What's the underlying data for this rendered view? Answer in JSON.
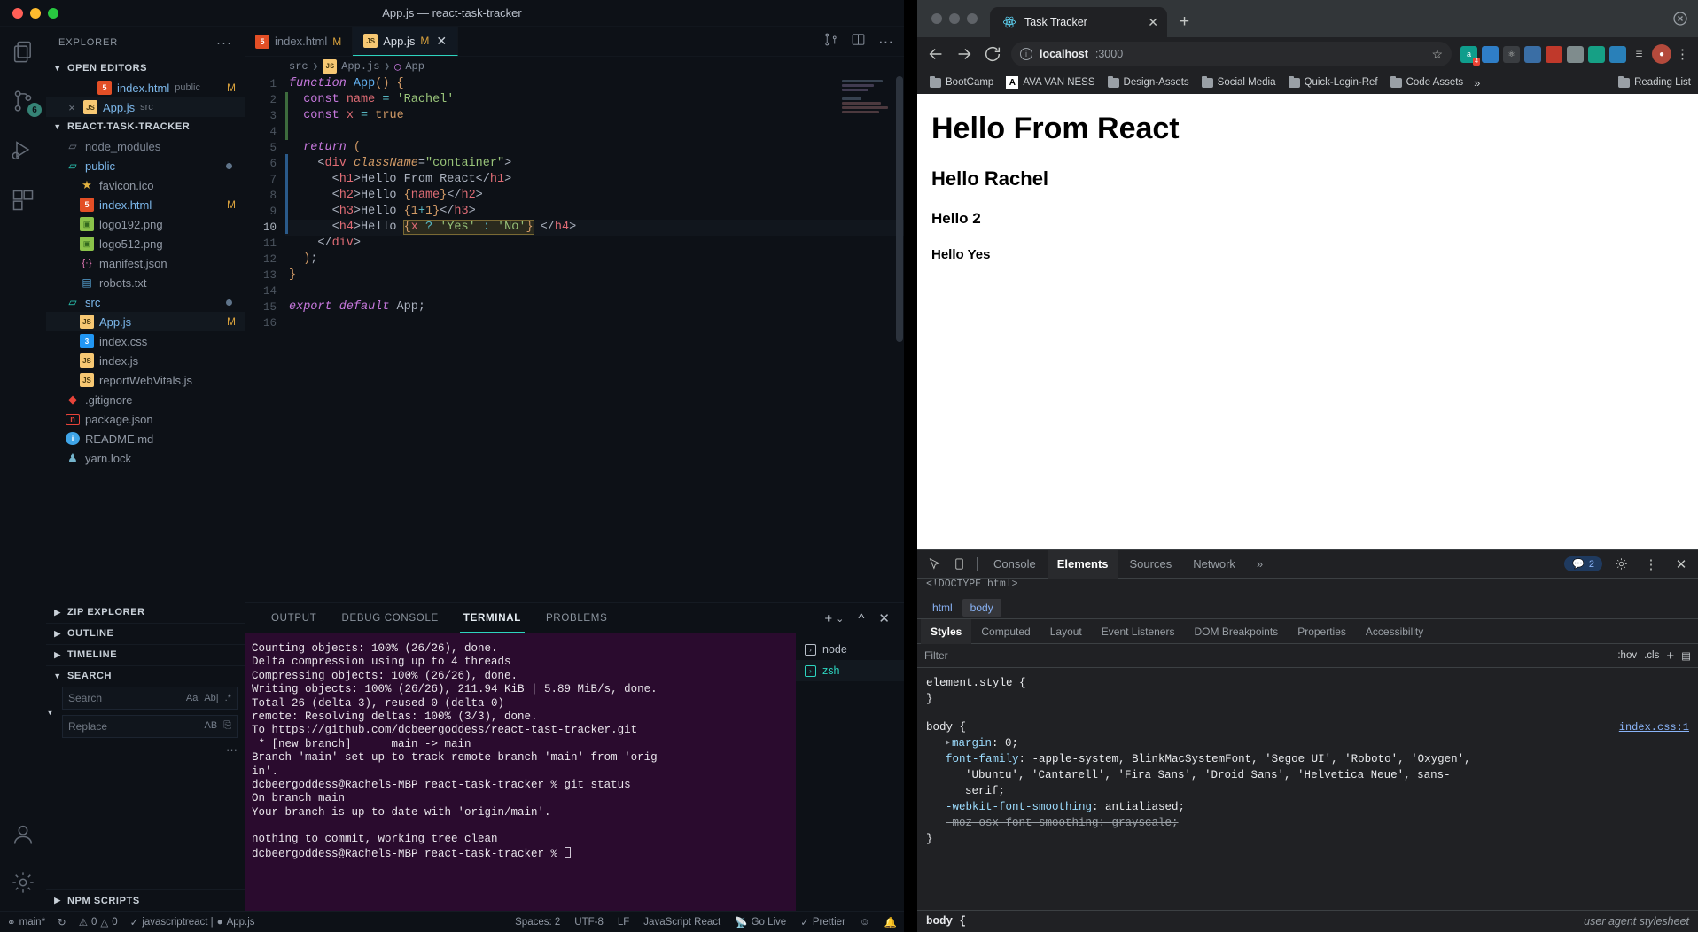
{
  "vscode": {
    "window_title": "App.js — react-task-tracker",
    "explorer_title": "EXPLORER",
    "sections": {
      "open_editors": "OPEN EDITORS",
      "project": "REACT-TASK-TRACKER",
      "zip_explorer": "ZIP EXPLORER",
      "outline": "OUTLINE",
      "timeline": "TIMELINE",
      "search": "SEARCH",
      "npm_scripts": "NPM SCRIPTS"
    },
    "open_editors": [
      {
        "name": "index.html",
        "folder": "public",
        "icon": "html-icon",
        "badge": "M",
        "close": ""
      },
      {
        "name": "App.js",
        "folder": "src",
        "icon": "js-icon",
        "badge": "",
        "close": "×"
      }
    ],
    "tree": [
      {
        "name": "node_modules",
        "icon": "folder-node-icon",
        "type": "folder-dim",
        "indent": 1,
        "badge": ""
      },
      {
        "name": "public",
        "icon": "folder-open-icon",
        "type": "folder",
        "indent": 1,
        "badge": "dot"
      },
      {
        "name": "favicon.ico",
        "icon": "star-icon",
        "type": "file",
        "indent": 2,
        "badge": ""
      },
      {
        "name": "index.html",
        "icon": "html-icon",
        "type": "file-blue",
        "indent": 2,
        "badge": "M"
      },
      {
        "name": "logo192.png",
        "icon": "image-icon",
        "type": "file",
        "indent": 2,
        "badge": ""
      },
      {
        "name": "logo512.png",
        "icon": "image-icon",
        "type": "file",
        "indent": 2,
        "badge": ""
      },
      {
        "name": "manifest.json",
        "icon": "json-icon",
        "type": "file",
        "indent": 2,
        "badge": ""
      },
      {
        "name": "robots.txt",
        "icon": "text-icon",
        "type": "file",
        "indent": 2,
        "badge": ""
      },
      {
        "name": "src",
        "icon": "folder-src-icon",
        "type": "folder",
        "indent": 1,
        "badge": "dot"
      },
      {
        "name": "App.js",
        "icon": "js-icon",
        "type": "file-blue-active",
        "indent": 2,
        "badge": "M"
      },
      {
        "name": "index.css",
        "icon": "css-icon",
        "type": "file",
        "indent": 2,
        "badge": ""
      },
      {
        "name": "index.js",
        "icon": "js-icon",
        "type": "file",
        "indent": 2,
        "badge": ""
      },
      {
        "name": "reportWebVitals.js",
        "icon": "js-icon",
        "type": "file",
        "indent": 2,
        "badge": ""
      },
      {
        "name": ".gitignore",
        "icon": "git-icon",
        "type": "file",
        "indent": 1,
        "badge": ""
      },
      {
        "name": "package.json",
        "icon": "npm-icon",
        "type": "file",
        "indent": 1,
        "badge": ""
      },
      {
        "name": "README.md",
        "icon": "info-icon",
        "type": "file",
        "indent": 1,
        "badge": ""
      },
      {
        "name": "yarn.lock",
        "icon": "yarn-icon",
        "type": "file",
        "indent": 1,
        "badge": ""
      }
    ],
    "search": {
      "search_placeholder": "Search",
      "replace_placeholder": "Replace",
      "opt_case": "Aa",
      "opt_word": "Ab|",
      "opt_regex": ".*",
      "opt_preserve": "AB",
      "opt_replace_all": "⎘",
      "more_dots": "···"
    },
    "tabs": [
      {
        "label": "index.html",
        "icon": "html-icon",
        "badge": "M",
        "active": false
      },
      {
        "label": "App.js",
        "icon": "js-icon",
        "badge": "M",
        "active": true
      }
    ],
    "breadcrumb": [
      "src",
      "App.js",
      "App"
    ],
    "editor": {
      "line_count": 16,
      "current_line": 10,
      "lines": [
        "function App() {",
        "  const name = 'Rachel'",
        "  const x = true",
        "",
        "  return (",
        "    <div className=\"container\">",
        "      <h1>Hello From React</h1>",
        "      <h2>Hello {name}</h2>",
        "      <h3>Hello {1+1}</h3>",
        "      <h4>Hello {x ? 'Yes' : 'No'} </h4>",
        "    </div>",
        "  );",
        "}",
        "",
        "export default App;",
        ""
      ]
    },
    "panel_tabs": [
      {
        "label": "OUTPUT",
        "active": false
      },
      {
        "label": "DEBUG CONSOLE",
        "active": false
      },
      {
        "label": "TERMINAL",
        "active": true
      },
      {
        "label": "PROBLEMS",
        "active": false
      }
    ],
    "terminal_lines": [
      "Counting objects: 100% (26/26), done.",
      "Delta compression using up to 4 threads",
      "Compressing objects: 100% (26/26), done.",
      "Writing objects: 100% (26/26), 211.94 KiB | 5.89 MiB/s, done.",
      "Total 26 (delta 3), reused 0 (delta 0)",
      "remote: Resolving deltas: 100% (3/3), done.",
      "To https://github.com/dcbeergoddess/react-tast-tracker.git",
      " * [new branch]      main -> main",
      "Branch 'main' set up to track remote branch 'main' from 'orig",
      "in'.",
      "dcbeergoddess@Rachels-MBP react-task-tracker % git status",
      "On branch main",
      "Your branch is up to date with 'origin/main'.",
      "",
      "nothing to commit, working tree clean",
      "dcbeergoddess@Rachels-MBP react-task-tracker % "
    ],
    "terminal_sessions": [
      {
        "label": "node",
        "active": false
      },
      {
        "label": "zsh",
        "active": true
      }
    ],
    "panel_actions": {
      "add": "+",
      "chevron": "⌄",
      "maximize": "^",
      "close": "✕"
    },
    "statusbar": {
      "branch": "main*",
      "sync": "↻",
      "errors": "0",
      "warnings": "0",
      "eslint": "javascriptreact |",
      "file": "App.js",
      "spaces": "Spaces: 2",
      "encoding": "UTF-8",
      "eol": "LF",
      "language": "JavaScript React",
      "golive": "Go Live",
      "prettier": "Prettier",
      "bell": "🔔"
    }
  },
  "browser": {
    "tab_title": "Task Tracker",
    "tab_close": "✕",
    "new_tab": "+",
    "url_host": "localhost",
    "url_rest": ":3000",
    "bookmarks": [
      {
        "label": "BootCamp",
        "icon": "folder-icon"
      },
      {
        "label": "AVA VAN NESS",
        "icon": "ava-icon"
      },
      {
        "label": "Design-Assets",
        "icon": "folder-icon"
      },
      {
        "label": "Social Media",
        "icon": "folder-icon"
      },
      {
        "label": "Quick-Login-Ref",
        "icon": "folder-icon"
      },
      {
        "label": "Code Assets",
        "icon": "folder-icon"
      }
    ],
    "bookmarks_overflow": "»",
    "reading_list": "Reading List",
    "extension_badge": "4",
    "page": {
      "h1": "Hello From React",
      "h2": "Hello Rachel",
      "h3": "Hello 2",
      "h4": "Hello Yes"
    }
  },
  "devtools": {
    "tabs": [
      {
        "label": "Console",
        "active": false
      },
      {
        "label": "Elements",
        "active": true
      },
      {
        "label": "Sources",
        "active": false
      },
      {
        "label": "Network",
        "active": false
      }
    ],
    "overflow": "»",
    "message_count": "2",
    "dom_line": "<!DOCTYPE html>",
    "crumbs": [
      {
        "label": "html",
        "active": false
      },
      {
        "label": "body",
        "active": true
      }
    ],
    "style_tabs": [
      {
        "label": "Styles",
        "active": true
      },
      {
        "label": "Computed",
        "active": false
      },
      {
        "label": "Layout",
        "active": false
      },
      {
        "label": "Event Listeners",
        "active": false
      },
      {
        "label": "DOM Breakpoints",
        "active": false
      },
      {
        "label": "Properties",
        "active": false
      },
      {
        "label": "Accessibility",
        "active": false
      }
    ],
    "filter_placeholder": "Filter",
    "filter_hov": ":hov",
    "filter_cls": ".cls",
    "filter_plus": "+",
    "rules": [
      {
        "selector": "element.style {",
        "source": "",
        "decls": [],
        "close": "}"
      },
      {
        "selector": "body {",
        "source": "index.css:1",
        "decls": [
          {
            "prop": "margin",
            "value": "0;",
            "expandable": true,
            "struck": false
          },
          {
            "prop": "font-family",
            "value": "-apple-system, BlinkMacSystemFont, 'Segoe UI', 'Roboto', 'Oxygen',",
            "expandable": false,
            "struck": false
          },
          {
            "prop": "",
            "value": "'Ubuntu', 'Cantarell', 'Fira Sans', 'Droid Sans', 'Helvetica Neue', sans-",
            "expandable": false,
            "struck": false
          },
          {
            "prop": "",
            "value": "serif;",
            "expandable": false,
            "struck": false
          },
          {
            "prop": "-webkit-font-smoothing",
            "value": "antialiased;",
            "expandable": false,
            "struck": false
          },
          {
            "prop": "-moz-osx-font-smoothing",
            "value": "grayscale;",
            "expandable": false,
            "struck": true
          }
        ],
        "close": "}"
      }
    ],
    "ua_selector": "body {",
    "ua_label": "user agent stylesheet"
  }
}
